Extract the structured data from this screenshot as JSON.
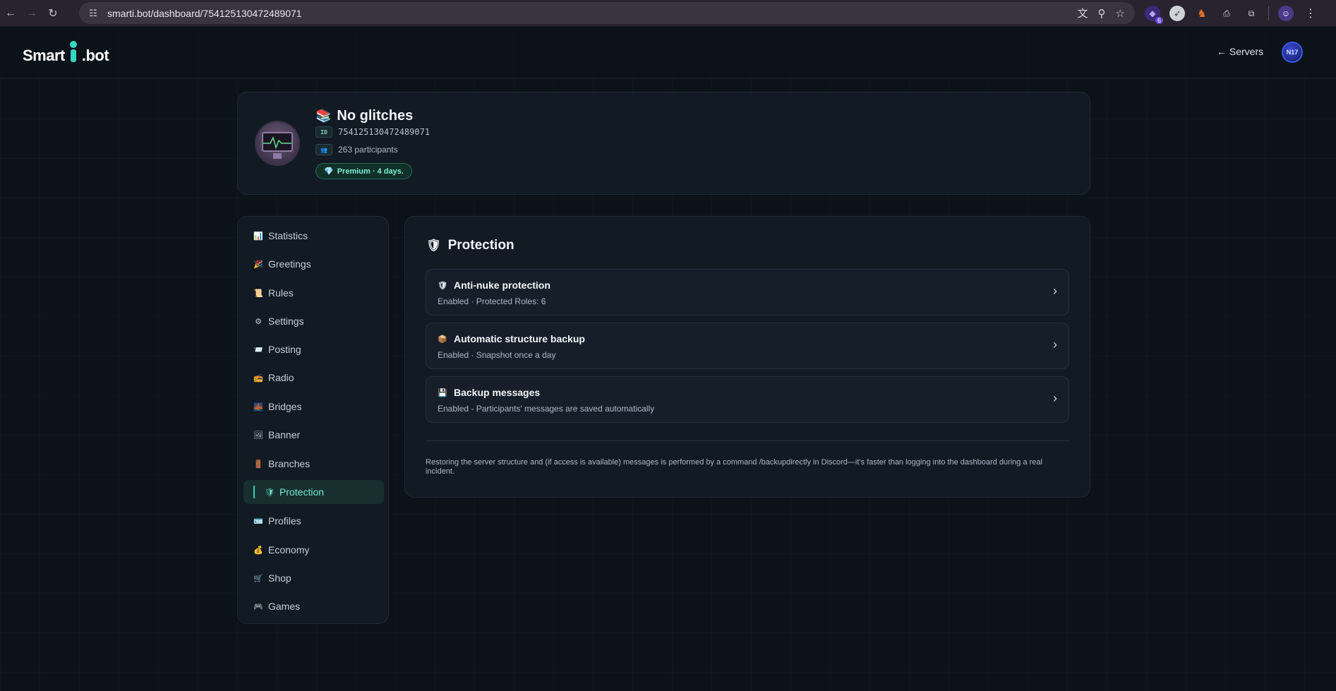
{
  "browser": {
    "url": "smarti.bot/dashboard/754125130472489071",
    "extension_badge": "6"
  },
  "header": {
    "logo_left": "Smart",
    "logo_right": ".bot",
    "servers_link": "← Servers",
    "user_avatar_text": "N17"
  },
  "server": {
    "emoji": "📚",
    "name": "No glitches",
    "id_tag": "ID",
    "id": "754125130472489071",
    "members_tag": "👥",
    "members": "263 participants",
    "premium": "Premium · 4 days."
  },
  "sidebar": {
    "items": [
      {
        "icon": "📊",
        "label": "Statistics"
      },
      {
        "icon": "🎉",
        "label": "Greetings"
      },
      {
        "icon": "📜",
        "label": "Rules"
      },
      {
        "icon": "⚙",
        "label": "Settings"
      },
      {
        "icon": "📨",
        "label": "Posting"
      },
      {
        "icon": "📻",
        "label": "Radio"
      },
      {
        "icon": "🌉",
        "label": "Bridges"
      },
      {
        "icon": "🖼",
        "label": "Banner"
      },
      {
        "icon": "🚪",
        "label": "Branches"
      },
      {
        "icon": "🛡",
        "label": "Protection"
      },
      {
        "icon": "🪪",
        "label": "Profiles"
      },
      {
        "icon": "💰",
        "label": "Economy"
      },
      {
        "icon": "🛒",
        "label": "Shop"
      },
      {
        "icon": "🎮",
        "label": "Games"
      }
    ],
    "active": "Protection"
  },
  "main": {
    "title_icon": "🛡",
    "title": "Protection",
    "options": [
      {
        "icon": "🛡",
        "title": "Anti-nuke protection",
        "subtitle": "Enabled · Protected Roles: 6"
      },
      {
        "icon": "📦",
        "title": "Automatic structure backup",
        "subtitle": "Enabled · Snapshot once a day"
      },
      {
        "icon": "💾",
        "title": "Backup messages",
        "subtitle": "Enabled - Participants' messages are saved automatically"
      }
    ],
    "footnote": "Restoring the server structure and (if access is available) messages is performed by a command /backupdirectly in Discord—it's faster than logging into the dashboard during a real incident."
  },
  "colors": {
    "background": "#0c1219",
    "card": "#121a23",
    "accent": "#39d3b7",
    "premium_bg": "#103028"
  }
}
